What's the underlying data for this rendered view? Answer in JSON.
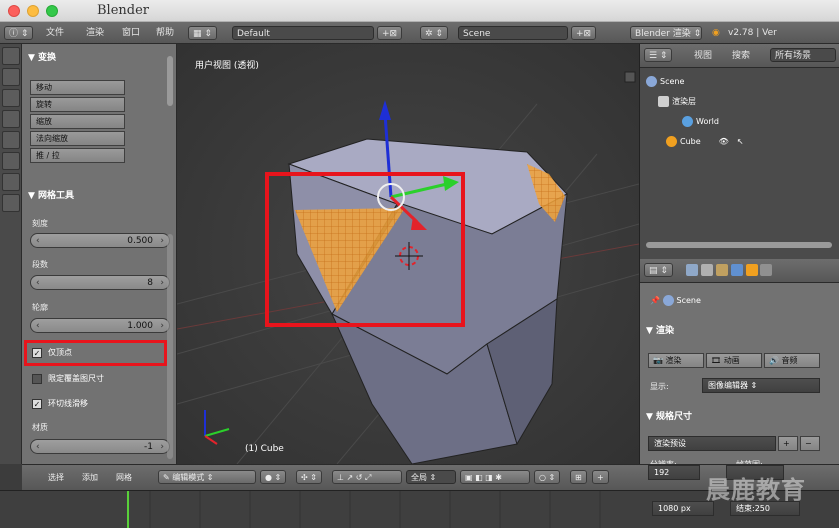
{
  "window": {
    "title": "Blender"
  },
  "info_header": {
    "menus": [
      "文件",
      "渲染",
      "窗口",
      "帮助"
    ],
    "layout": "Default",
    "scene": "Scene",
    "engine": "Blender 渲染",
    "version": "v2.78 | Ver"
  },
  "tool_shelf": {
    "transform_header": "▼ 变换",
    "transform_buttons": [
      "移动",
      "旋转",
      "缩放",
      "法向缩放",
      "推 / 拉"
    ],
    "mesh_tools_header": "▼ 网格工具",
    "fields": [
      {
        "label": "刻度",
        "value": "0.500"
      },
      {
        "label": "段数",
        "value": "8"
      },
      {
        "label": "轮廓",
        "value": "1.000"
      }
    ],
    "checkboxes": [
      {
        "label": "仅顶点",
        "checked": true
      },
      {
        "label": "限定覆盖图尺寸",
        "checked": false
      },
      {
        "label": "环切线滑移",
        "checked": true
      }
    ],
    "material": {
      "label": "材质",
      "value": "-1"
    }
  },
  "viewport": {
    "view_label": "用户视图 (透视)",
    "object_label": "(1) Cube"
  },
  "bottom_header": {
    "menus": [
      "选择",
      "添加",
      "网格"
    ],
    "mode": "编辑模式",
    "pivot": "全局"
  },
  "outliner": {
    "view_menu": "视图",
    "search_menu": "搜索",
    "filter": "所有场景",
    "items": [
      {
        "label": "Scene",
        "indent": 0
      },
      {
        "label": "渲染层",
        "indent": 1
      },
      {
        "label": "World",
        "indent": 2
      },
      {
        "label": "Cube",
        "indent": 1
      }
    ]
  },
  "properties": {
    "scene_label": "Scene",
    "render_header": "▼ 渲染",
    "render_buttons": [
      "渲染",
      "动画",
      "音频"
    ],
    "display_label": "显示:",
    "display_value": "图像编辑器",
    "dimensions_header": "▼ 规格尺寸",
    "preset": "渲染预设",
    "resolution_label": "分辨率:",
    "frame_range_label": "帧范围:",
    "res_x": "192",
    "res_y": "1080 px",
    "end_frame": "结束:250"
  },
  "watermark": "晨鹿教育",
  "colors": {
    "selection_red": "#e8141c",
    "face_orange": "#f2a33a",
    "axis_blue": "#1e2fd6",
    "axis_green": "#2bd02b"
  }
}
